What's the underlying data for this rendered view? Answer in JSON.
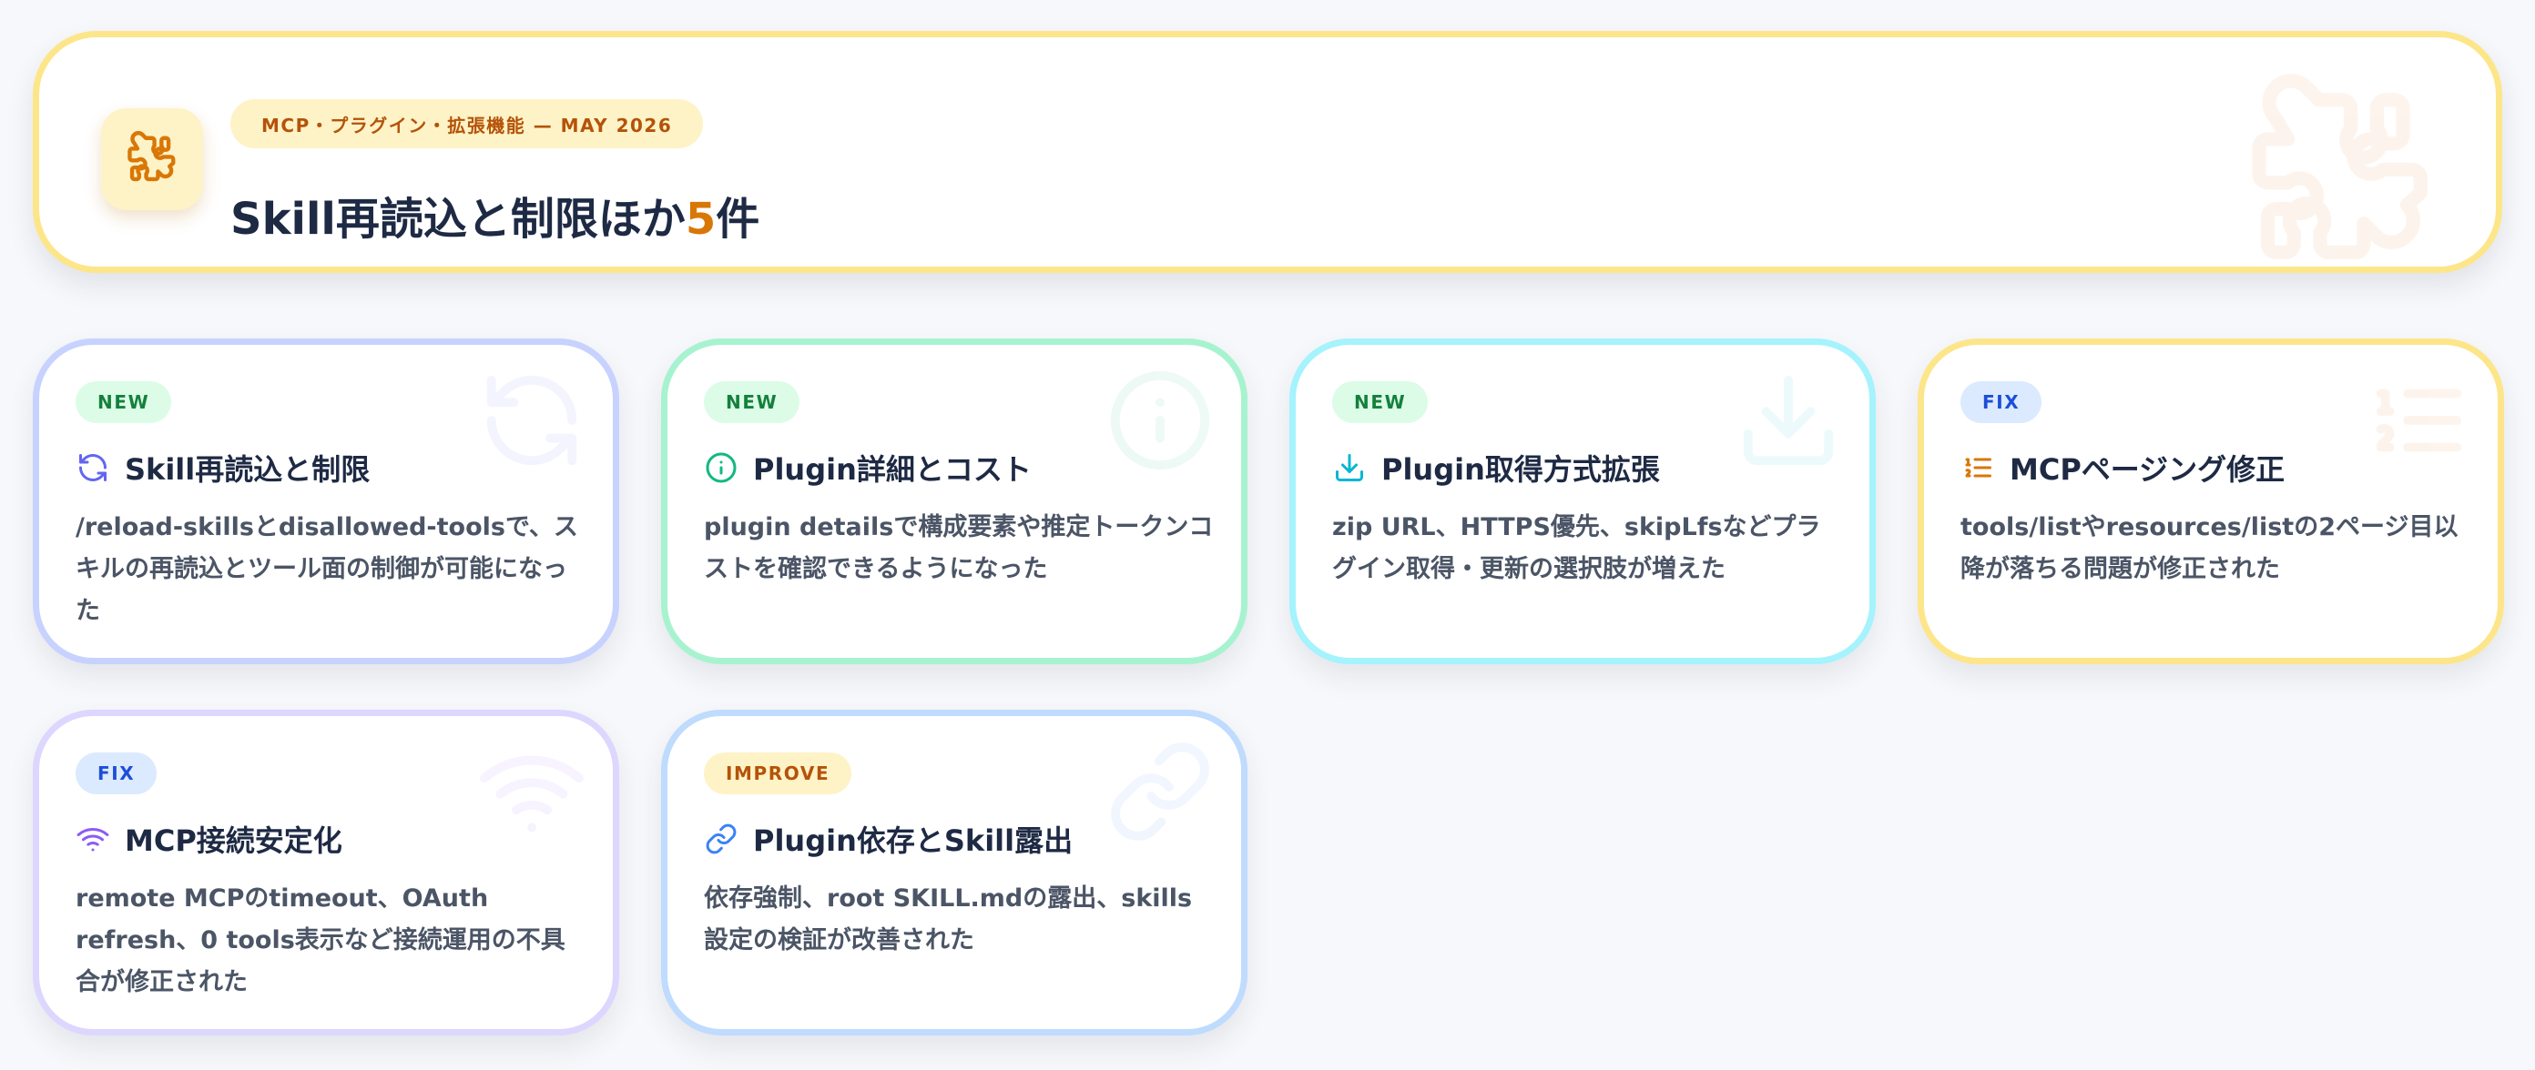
{
  "header": {
    "tag": "MCP・プラグイン・拡張機能 — MAY 2026",
    "title_main": "Skill再読込と制限ほか",
    "title_count": "5",
    "title_suffix": "件",
    "icon": "puzzle-icon",
    "accent_color": "#d97706",
    "border_color": "#fde68a"
  },
  "cards": [
    {
      "badge": "NEW",
      "title": "Skill再読込と制限",
      "description": "/reload-skillsとdisallowed-toolsで、スキルの再読込とツール面の制御が可能になった",
      "icon": "refresh-icon",
      "border_color": "#c7d2fe",
      "icon_color": "#6366f1"
    },
    {
      "badge": "NEW",
      "title": "Plugin詳細とコスト",
      "description": "plugin detailsで構成要素や推定トークンコストを確認できるようになった",
      "icon": "info-icon",
      "border_color": "#a7f3d0",
      "icon_color": "#10b981"
    },
    {
      "badge": "NEW",
      "title": "Plugin取得方式拡張",
      "description": "zip URL、HTTPS優先、skipLfsなどプラグイン取得・更新の選択肢が増えた",
      "icon": "download-icon",
      "border_color": "#a5f3fc",
      "icon_color": "#06b6d4"
    },
    {
      "badge": "FIX",
      "title": "MCPページング修正",
      "description": "tools/listやresources/listの2ページ目以降が落ちる問題が修正された",
      "icon": "ordered-list-icon",
      "border_color": "#fde68a",
      "icon_color": "#d97706"
    },
    {
      "badge": "FIX",
      "title": "MCP接続安定化",
      "description": "remote MCPのtimeout、OAuth refresh、0 tools表示など接続運用の不具合が修正された",
      "icon": "wifi-icon",
      "border_color": "#ddd6fe",
      "icon_color": "#8b5cf6"
    },
    {
      "badge": "IMPROVE",
      "title": "Plugin依存とSkill露出",
      "description": "依存強制、root SKILL.mdの露出、skills設定の検証が改善された",
      "icon": "link-icon",
      "border_color": "#bfdbfe",
      "icon_color": "#3b82f6"
    }
  ],
  "badge_colors": {
    "NEW": {
      "bg": "#dcfce7",
      "fg": "#15803d"
    },
    "FIX": {
      "bg": "#dbeafe",
      "fg": "#1d4ed8"
    },
    "IMPROVE": {
      "bg": "#fef3c7",
      "fg": "#b45309"
    }
  }
}
